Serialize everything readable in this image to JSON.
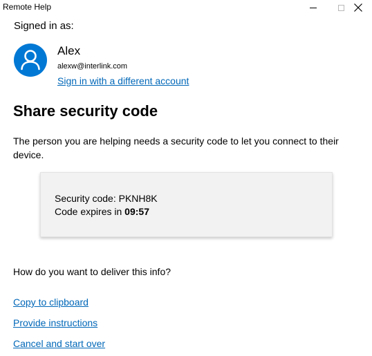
{
  "window": {
    "title": "Remote Help",
    "controls": {
      "minimize_icon": "minimize-icon",
      "maximize_icon": "maximize-icon",
      "close_icon": "close-icon"
    }
  },
  "account": {
    "signed_in_label": "Signed in as:",
    "avatar_icon": "user-avatar-icon",
    "name": "Alex",
    "email": "alexw@interlink.com",
    "switch_account_link": "Sign in with a different account"
  },
  "main": {
    "heading": "Share security code",
    "instructions": "The person you are helping needs a security code to let you connect to their device.",
    "code_card": {
      "code_label": "Security code: ",
      "code_value": "PKNH8K",
      "expires_label": "Code expires in ",
      "expires_value": "09:57"
    },
    "deliver_question": "How do you want to deliver this info?",
    "actions": [
      {
        "label": "Copy to clipboard"
      },
      {
        "label": "Provide instructions"
      },
      {
        "label": "Cancel and start over"
      }
    ]
  },
  "colors": {
    "accent": "#0078d4",
    "link": "#0067b8",
    "card_background": "#f2f2f2"
  }
}
